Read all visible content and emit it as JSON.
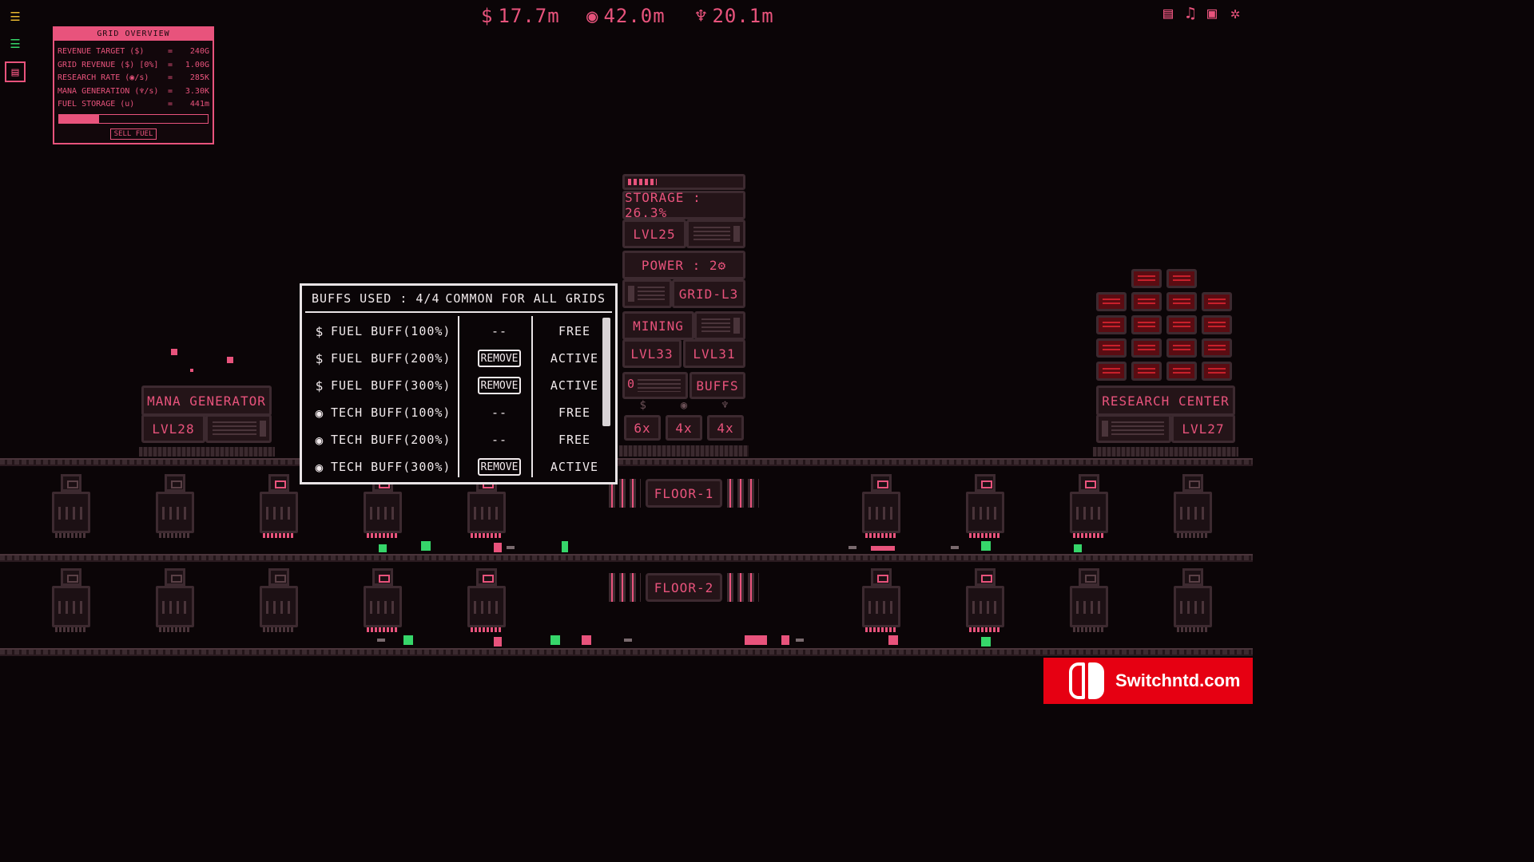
{
  "top_stats": [
    {
      "icon": "dollar-icon",
      "glyph": "$",
      "value": "17.7m"
    },
    {
      "icon": "eye-icon",
      "glyph": "◉",
      "value": "42.0m"
    },
    {
      "icon": "mana-icon",
      "glyph": "♆",
      "value": "20.1m"
    }
  ],
  "sidebar": [
    {
      "name": "sidebar-grid-icon-1",
      "glyph": "☰"
    },
    {
      "name": "sidebar-grid-icon-2",
      "glyph": "☰"
    },
    {
      "name": "sidebar-grid-icon-3",
      "glyph": "▤"
    }
  ],
  "system_icons": [
    {
      "name": "stats-icon",
      "glyph": "▤"
    },
    {
      "name": "music-icon",
      "glyph": "♫"
    },
    {
      "name": "save-icon",
      "glyph": "▣"
    },
    {
      "name": "settings-icon",
      "glyph": "✲"
    }
  ],
  "overview": {
    "title": "GRID OVERVIEW",
    "rows": [
      {
        "k": "REVENUE TARGET ($)",
        "v": "240G"
      },
      {
        "k": "GRID REVENUE ($) [0%]",
        "v": "1.00G"
      },
      {
        "k": "RESEARCH RATE (◉/s)",
        "v": "285K"
      },
      {
        "k": "MANA GENERATION (♆/s)",
        "v": "3.30K"
      },
      {
        "k": "FUEL STORAGE (u)",
        "v": "441m"
      }
    ],
    "eq": "=",
    "fuel_fill": 0.27,
    "sell_label": "SELL FUEL"
  },
  "mana_generator": {
    "title": "MANA GENERATOR",
    "level": "LVL28"
  },
  "research_center": {
    "title": "RESEARCH CENTER",
    "level": "LVL27"
  },
  "tower": {
    "storage": "STORAGE : 26.3%",
    "storage_fill": 0.26,
    "level": "LVL25",
    "power": "POWER : 2⚙",
    "grid": "GRID-L3",
    "mining": "MINING",
    "lvl_a": "LVL33",
    "lvl_b": "LVL31",
    "buffs_label": "BUFFS",
    "buff_count": "0",
    "buff_icons": [
      "$",
      "◉",
      "♆"
    ],
    "buff_multipliers": [
      "6x",
      "4x",
      "4x"
    ]
  },
  "buffs_panel": {
    "used": "BUFFS USED : 4/4",
    "common": "COMMON FOR ALL GRIDS",
    "rows": [
      {
        "icon": "$",
        "name": "FUEL BUFF(100%)",
        "action": "--",
        "status": "FREE"
      },
      {
        "icon": "$",
        "name": "FUEL BUFF(200%)",
        "action": "REMOVE",
        "status": "ACTIVE"
      },
      {
        "icon": "$",
        "name": "FUEL BUFF(300%)",
        "action": "REMOVE",
        "status": "ACTIVE"
      },
      {
        "icon": "◉",
        "name": "TECH BUFF(100%)",
        "action": "--",
        "status": "FREE"
      },
      {
        "icon": "◉",
        "name": "TECH BUFF(200%)",
        "action": "--",
        "status": "FREE"
      },
      {
        "icon": "◉",
        "name": "TECH BUFF(300%)",
        "action": "REMOVE",
        "status": "ACTIVE"
      }
    ]
  },
  "floors": [
    "FLOOR-1",
    "FLOOR-2"
  ],
  "badge": {
    "text": "Switchntd.com"
  }
}
